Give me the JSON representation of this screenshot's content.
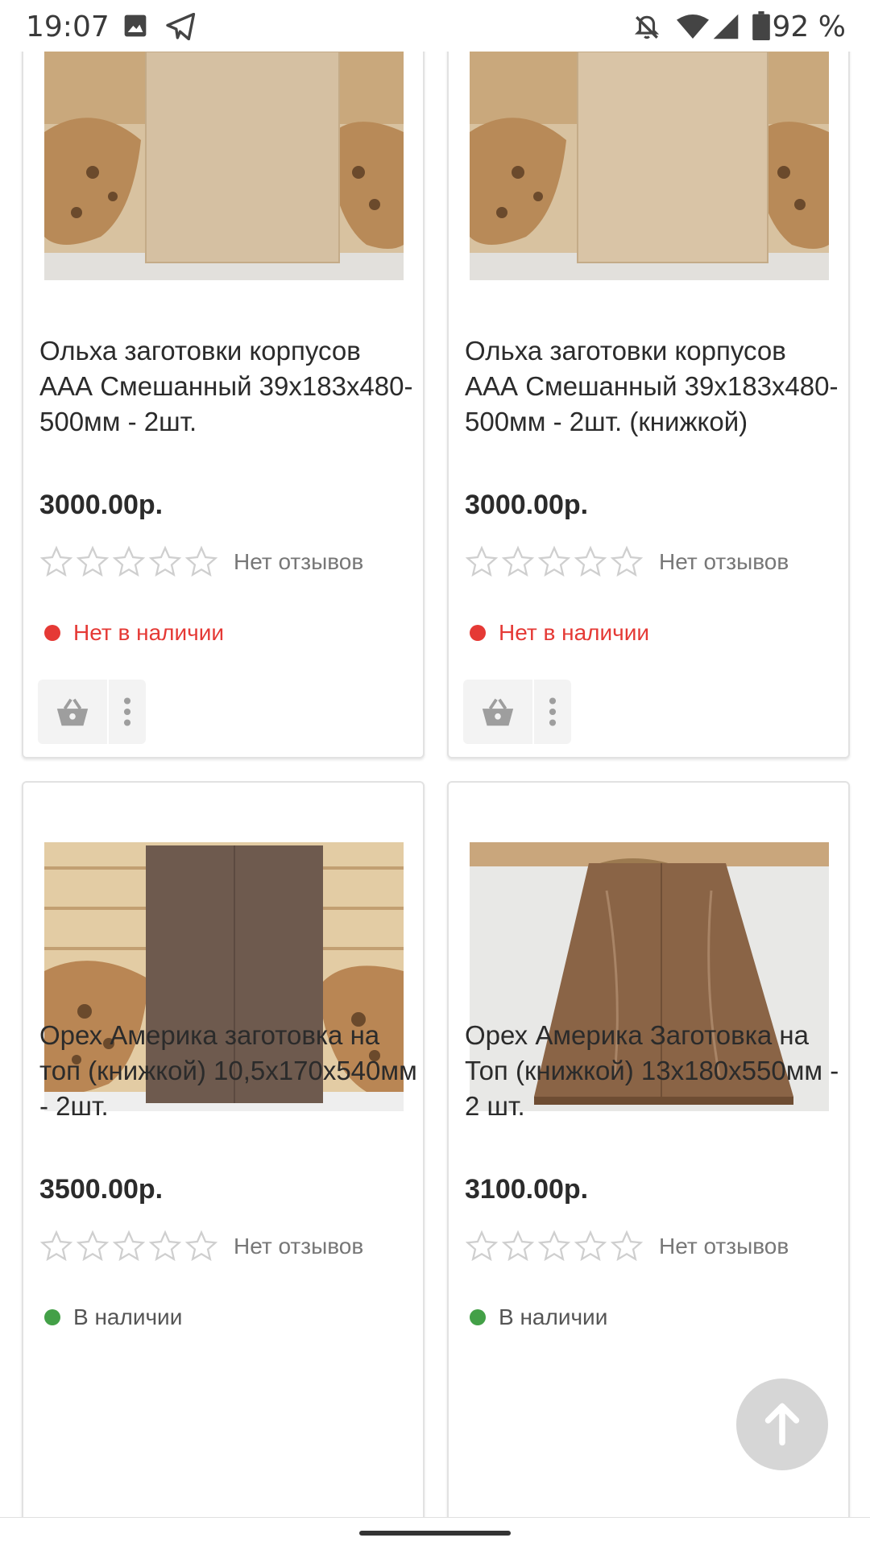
{
  "status_bar": {
    "time": "19:07",
    "battery": "92 %",
    "icons": [
      "image-icon",
      "telegram-icon",
      "notifications-off-icon",
      "wifi-icon",
      "signal-icon",
      "battery-icon"
    ]
  },
  "products": [
    {
      "title": "Ольха заготовки корпусов ААА Смешанный 39х183х480-500мм - 2шт.",
      "price": "3000.00р.",
      "reviews": "Нет отзывов",
      "stock": "Нет в наличии",
      "stock_color": "#e53935",
      "wood_color": "#d2b996"
    },
    {
      "title": "Ольха заготовки корпусов ААА Смешанный 39х183х480-500мм - 2шт. (книжкой)",
      "price": "3000.00р.",
      "reviews": "Нет отзывов",
      "stock": "Нет в наличии",
      "stock_color": "#e53935",
      "wood_color": "#d2b996"
    },
    {
      "title": "Орех Америка заготовка на топ (книжкой) 10,5х170х540мм - 2шт.",
      "price": "3500.00р.",
      "reviews": "Нет отзывов",
      "stock": "В наличии",
      "stock_color": "#43a047",
      "wood_color": "#6e5a4e"
    },
    {
      "title": "Орех Америка Заготовка на Топ (книжкой) 13х180х550мм - 2 шт.",
      "price": "3100.00р.",
      "reviews": "Нет отзывов",
      "stock": "В наличии",
      "stock_color": "#43a047",
      "wood_color": "#8a6446"
    }
  ],
  "rating_stars": 0,
  "rating_max": 5,
  "colors": {
    "star_outline": "#cfcfcf",
    "icon_gray": "#9e9e9e",
    "card_border": "#e2e2e2"
  },
  "icons": {
    "cart": "basket-icon",
    "more": "more-vert-icon",
    "scroll_top": "arrow-up-icon"
  }
}
